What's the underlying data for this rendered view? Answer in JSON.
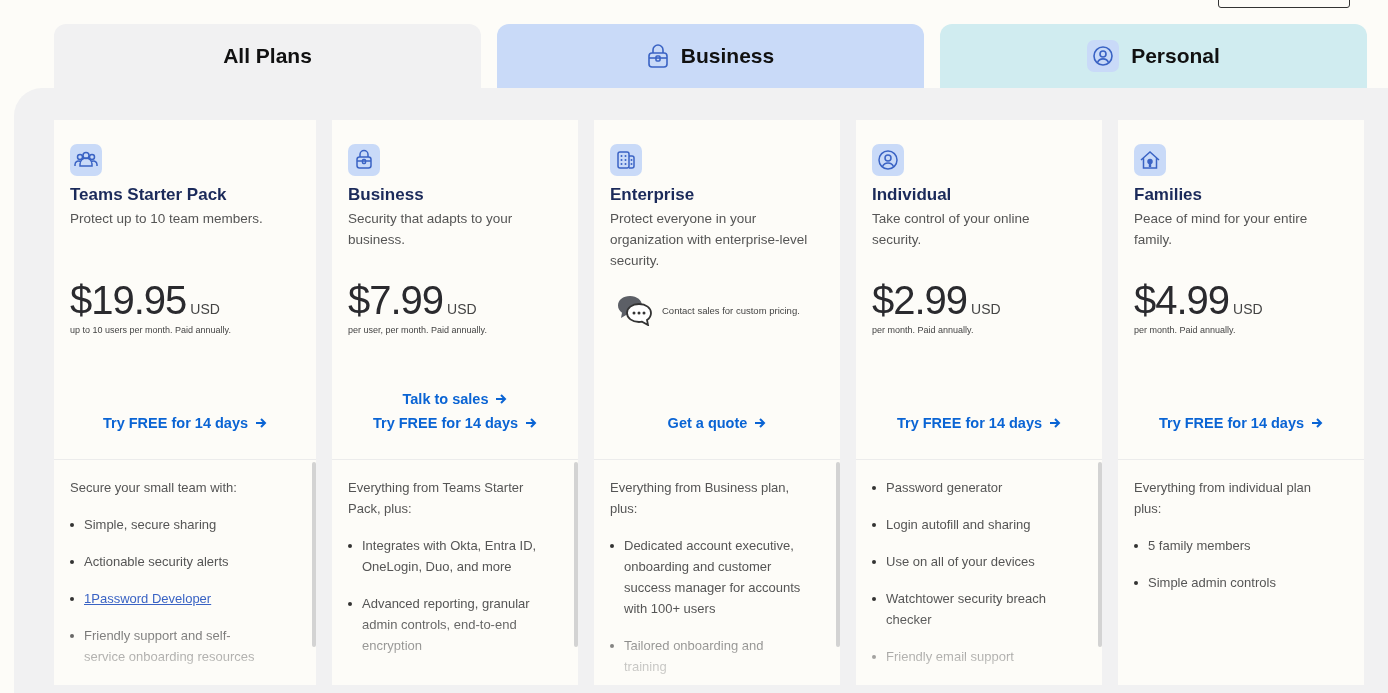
{
  "tabs": [
    {
      "label": "All Plans",
      "selected": true
    },
    {
      "label": "Business",
      "selected": false,
      "color": "#c9daf8"
    },
    {
      "label": "Personal",
      "selected": false,
      "color": "#d0ecf0"
    }
  ],
  "plans": [
    {
      "title": "Teams Starter Pack",
      "description": "Protect up to 10 team members.",
      "price": "$19.95",
      "currency": "USD",
      "price_note": "up to 10 users per month. Paid annually.",
      "actions": [
        "Try FREE for 14 days"
      ],
      "scrollable": true,
      "intro": "Secure your small team with:",
      "features": [
        {
          "text": "Simple, secure sharing",
          "kind": "text"
        },
        {
          "text": "Actionable security alerts",
          "kind": "text"
        },
        {
          "text": "1Password Developer",
          "kind": "link"
        },
        {
          "text": "Friendly support and self-service onboarding resources",
          "kind": "text"
        }
      ]
    },
    {
      "title": "Business",
      "description": "Security that adapts to your business.",
      "price": "$7.99",
      "currency": "USD",
      "price_note": "per user, per month. Paid annually.",
      "actions": [
        "Talk to sales",
        "Try FREE for 14 days"
      ],
      "scrollable": true,
      "intro": "Everything from Teams Starter Pack, plus:",
      "features": [
        {
          "text": "Integrates with Okta, Entra ID, OneLogin, Duo, and more",
          "kind": "text"
        },
        {
          "text": "Advanced reporting, granular admin controls, end-to-end encryption",
          "kind": "text"
        }
      ]
    },
    {
      "title": "Enterprise",
      "description": "Protect everyone in your organization with enterprise-level security.",
      "contact_note": "Contact sales for custom pricing.",
      "actions": [
        "Get a quote"
      ],
      "scrollable": true,
      "intro": "Everything from Business plan, plus:",
      "features": [
        {
          "text": "Dedicated account executive, onboarding and customer success manager for accounts with 100+ users",
          "kind": "text"
        },
        {
          "text": "Tailored onboarding and training",
          "kind": "text"
        }
      ]
    },
    {
      "title": "Individual",
      "description": "Take control of your online security.",
      "price": "$2.99",
      "currency": "USD",
      "price_note": "per month. Paid annually.",
      "actions": [
        "Try FREE for 14 days"
      ],
      "scrollable": true,
      "features": [
        {
          "text": "Password generator",
          "kind": "text"
        },
        {
          "text": "Login autofill and sharing",
          "kind": "text"
        },
        {
          "text": "Use on all of your devices",
          "kind": "text"
        },
        {
          "text": "Watchtower security breach checker",
          "kind": "text"
        },
        {
          "text": "Friendly email support",
          "kind": "text"
        }
      ]
    },
    {
      "title": "Families",
      "description": "Peace of mind for your entire family.",
      "price": "$4.99",
      "currency": "USD",
      "price_note": "per month. Paid annually.",
      "actions": [
        "Try FREE for 14 days"
      ],
      "scrollable": false,
      "intro": "Everything from individual plan plus:",
      "features": [
        {
          "text": "5 family members",
          "kind": "text"
        },
        {
          "text": "Simple admin controls",
          "kind": "text"
        }
      ]
    }
  ]
}
